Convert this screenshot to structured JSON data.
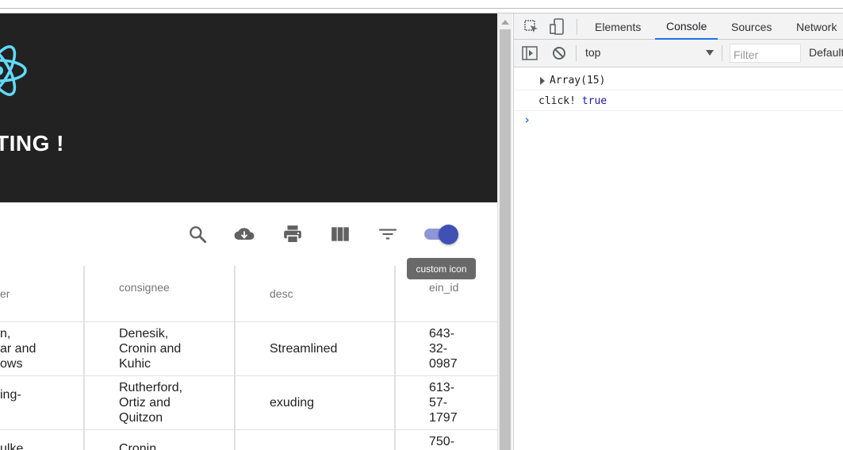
{
  "app": {
    "header_title": "TING !",
    "toolbar_icons": [
      "search-icon",
      "cloud-download-icon",
      "print-icon",
      "view-column-icon",
      "filter-list-icon"
    ],
    "toggle_on": true,
    "tooltip": "custom icon",
    "table": {
      "columns": [
        "er",
        "consignee",
        "desc",
        "ein_id"
      ],
      "rows": [
        {
          "col0": [
            "n,",
            "ar and",
            "ows"
          ],
          "consignee": [
            "Denesik,",
            "Cronin and",
            "Kuhic"
          ],
          "desc": "Streamlined",
          "id": [
            "643-",
            "32-",
            "0987"
          ]
        },
        {
          "col0": [
            "ing-"
          ],
          "consignee": [
            "Rutherford,",
            "Ortiz and",
            "Quitzon"
          ],
          "desc": "exuding",
          "id": [
            "613-",
            "57-",
            "1797"
          ]
        },
        {
          "col0": [
            "ulke"
          ],
          "consignee": [
            "Cronin"
          ],
          "desc": "",
          "id": [
            "750-"
          ]
        }
      ]
    }
  },
  "devtools": {
    "tabs": [
      "Elements",
      "Console",
      "Sources",
      "Network"
    ],
    "active_tab": "Console",
    "context": "top",
    "filter_placeholder": "Filter",
    "levels_label": "Default",
    "logs": [
      {
        "text": "Array(15)",
        "expandable": true
      },
      {
        "text": "click!",
        "value": "true"
      }
    ],
    "accent_color": "#1a73e8"
  }
}
